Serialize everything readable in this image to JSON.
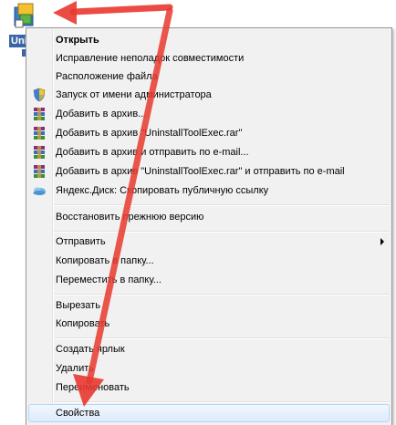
{
  "desktop_icon": {
    "label": "Uni"
  },
  "menu": {
    "items": [
      {
        "label": "Открыть",
        "bold": true
      },
      {
        "label": "Исправление неполадок совместимости"
      },
      {
        "label": "Расположение файла"
      },
      {
        "label": "Запуск от имени администратора",
        "icon": "shield-icon"
      },
      {
        "label": "Добавить в архив...",
        "icon": "winrar-icon"
      },
      {
        "label": "Добавить в архив \"UninstallToolExec.rar\"",
        "icon": "winrar-icon"
      },
      {
        "label": "Добавить в архив и отправить по e-mail...",
        "icon": "winrar-icon"
      },
      {
        "label": "Добавить в архив \"UninstallToolExec.rar\" и отправить по e-mail",
        "icon": "winrar-icon"
      },
      {
        "label": "Яндекс.Диск: Скопировать публичную ссылку",
        "icon": "yandex-disk-icon"
      },
      {
        "label": "Восстановить прежнюю версию"
      },
      {
        "label": "Отправить",
        "submenu": true
      },
      {
        "label": "Копировать в папку..."
      },
      {
        "label": "Переместить в папку..."
      },
      {
        "label": "Вырезать"
      },
      {
        "label": "Копировать"
      },
      {
        "label": "Создать ярлык"
      },
      {
        "label": "Удалить"
      },
      {
        "label": "Переименовать"
      },
      {
        "label": "Свойства",
        "selected": true
      }
    ]
  },
  "colors": {
    "arrow": "#e8392f",
    "selection_border": "#b8d6fb",
    "menu_bg": "#f1f1f1"
  }
}
